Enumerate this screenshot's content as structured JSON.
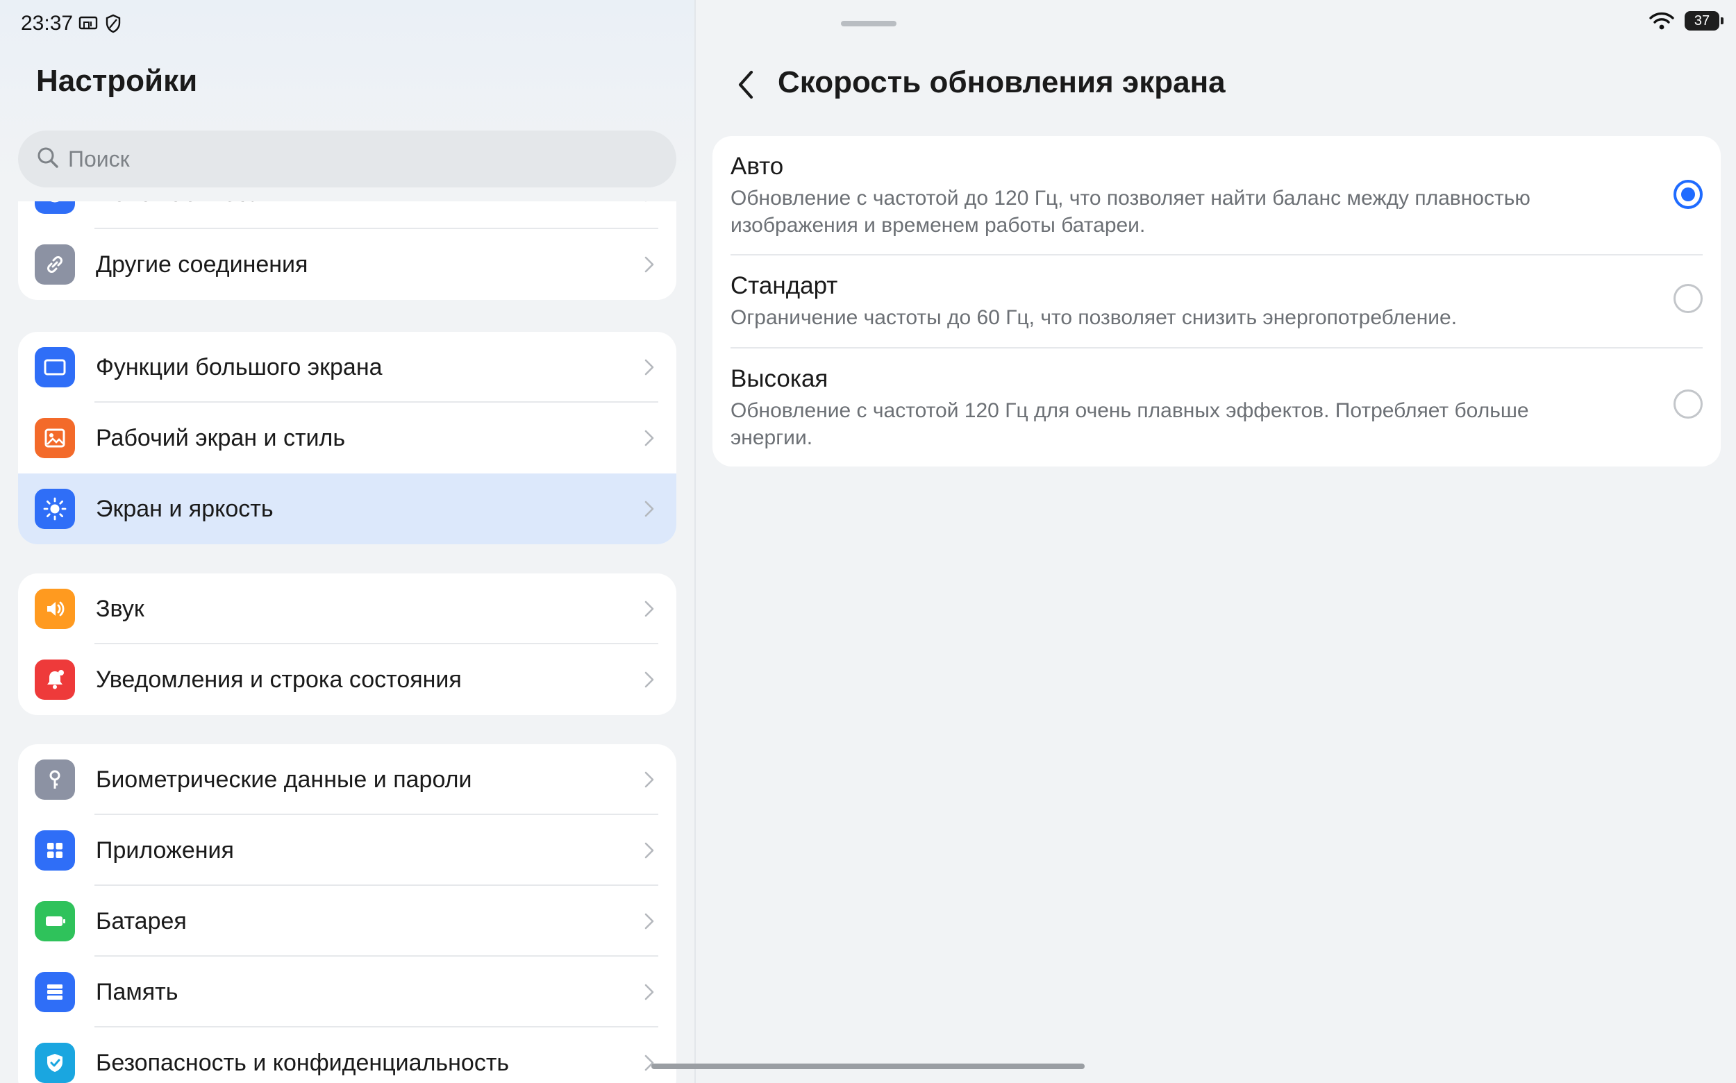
{
  "status_bar": {
    "time": "23:37",
    "battery_level": "37",
    "icons": [
      "screen-cast-icon",
      "shield-icon",
      "wifi-icon",
      "battery-icon"
    ]
  },
  "left_pane": {
    "title": "Настройки",
    "search_placeholder": "Поиск",
    "groups": [
      {
        "items": [
          {
            "label": "Honor Connect",
            "icon": "connect-icon",
            "color": "#2f6ef7"
          },
          {
            "label": "Другие соединения",
            "icon": "link-icon",
            "color": "#8c92a3"
          }
        ]
      },
      {
        "items": [
          {
            "label": "Функции большого экрана",
            "icon": "tablet-icon",
            "color": "#2f6ef7"
          },
          {
            "label": "Рабочий экран и стиль",
            "icon": "image-icon",
            "color": "#f36a2a"
          },
          {
            "label": "Экран и яркость",
            "icon": "brightness-icon",
            "color": "#2f6ef7",
            "selected": true
          }
        ]
      },
      {
        "items": [
          {
            "label": "Звук",
            "icon": "speaker-icon",
            "color": "#ff9a1f"
          },
          {
            "label": "Уведомления и строка состояния",
            "icon": "bell-icon",
            "color": "#ee3a3a"
          }
        ]
      },
      {
        "items": [
          {
            "label": "Биометрические данные и пароли",
            "icon": "key-icon",
            "color": "#8c92a3"
          },
          {
            "label": "Приложения",
            "icon": "apps-grid-icon",
            "color": "#2f6ef7"
          },
          {
            "label": "Батарея",
            "icon": "battery-icon",
            "color": "#2fc25b"
          },
          {
            "label": "Память",
            "icon": "storage-icon",
            "color": "#2f6ef7"
          },
          {
            "label": "Безопасность и конфиденциальность",
            "icon": "shield-check-icon",
            "color": "#1aa6e0"
          }
        ]
      }
    ]
  },
  "right_pane": {
    "title": "Скорость обновления экрана",
    "options": [
      {
        "title": "Авто",
        "description": "Обновление с частотой до 120 Гц, что позволяет найти баланс между плавностью изображения и временем работы батареи.",
        "selected": true
      },
      {
        "title": "Стандарт",
        "description": "Ограничение частоты до 60 Гц, что позволяет снизить энергопотребление.",
        "selected": false
      },
      {
        "title": "Высокая",
        "description": "Обновление с частотой 120 Гц для очень плавных эффектов. Потребляет больше энергии.",
        "selected": false
      }
    ],
    "accent_color": "#1f6bff"
  }
}
